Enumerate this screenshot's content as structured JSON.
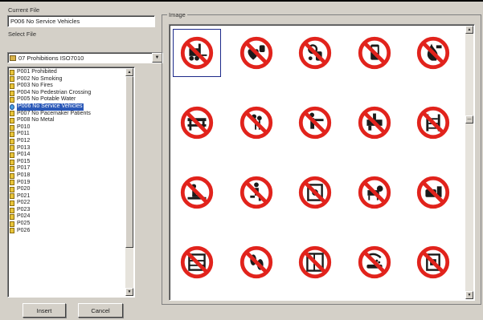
{
  "current_file": {
    "label": "Current File",
    "value": "P006 No Service Vehicles"
  },
  "select_file": {
    "label": "Select File",
    "value": "07 Prohibitions ISO7010",
    "icon": "folder-icon"
  },
  "list": {
    "items": [
      "P001 Prohibited",
      "P002 No Smoking",
      "P003 No Fires",
      "P004 No Pedestrian Crossing",
      "P005 No Potable Water",
      "P006 No Service Vehicles",
      "P007 No Pacemaker Patients",
      "P008 No Metal",
      "P010",
      "P011",
      "P012",
      "P013",
      "P014",
      "P015",
      "P017",
      "P018",
      "P019",
      "P020",
      "P021",
      "P022",
      "P023",
      "P024",
      "P025",
      "P026"
    ],
    "selected_index": 5
  },
  "buttons": {
    "insert": "Insert",
    "cancel": "Cancel"
  },
  "image": {
    "label": "Image",
    "signs": [
      "forklift",
      "pacemaker",
      "metal-objects",
      "phone",
      "fire-flame",
      "barrier",
      "flowers",
      "person-touch",
      "tool-use",
      "ladder",
      "sit-person",
      "climb-person",
      "machine",
      "dog",
      "food",
      "shelves",
      "footprints",
      "cage",
      "shower",
      "box"
    ],
    "selected_index": 0,
    "colors": {
      "ring": "#e1231c",
      "symbol": "#1a1a1a"
    }
  }
}
